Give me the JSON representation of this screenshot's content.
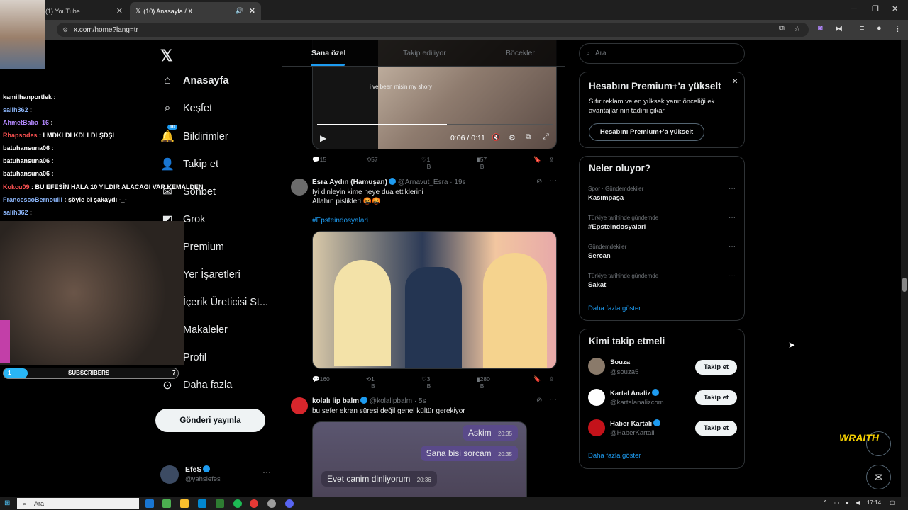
{
  "browser": {
    "tabs": [
      {
        "title": "(1) YouTube"
      },
      {
        "title": "(10) Anasayfa / X"
      }
    ],
    "url": "x.com/home?lang=tr"
  },
  "x": {
    "nav": [
      {
        "label": "Anasayfa",
        "icon": "home-icon"
      },
      {
        "label": "Keşfet",
        "icon": "search-icon"
      },
      {
        "label": "Bildirimler",
        "icon": "bell-icon",
        "badge": "10"
      },
      {
        "label": "Takip et",
        "icon": "add-user-icon"
      },
      {
        "label": "Sohbet",
        "icon": "chat-icon"
      },
      {
        "label": "Grok",
        "icon": "grok-icon"
      },
      {
        "label": "Premium",
        "icon": "x-logo-icon"
      },
      {
        "label": "Yer İşaretleri",
        "icon": "bookmark-icon"
      },
      {
        "label": "İçerik Üreticisi St...",
        "icon": "studio-icon"
      },
      {
        "label": "Makaleler",
        "icon": "article-icon"
      },
      {
        "label": "Profil",
        "icon": "person-icon"
      },
      {
        "label": "Daha fazla",
        "icon": "more-icon"
      }
    ],
    "post_button": "Gönderi yayınla",
    "account": {
      "name": "EfeS",
      "handle": "@yahslefes"
    },
    "feed_tabs": [
      "Sana özel",
      "Takip ediliyor",
      "Böcekler"
    ],
    "video_post": {
      "caption": "i ve been misin my shory",
      "time": "0:06 / 0:11",
      "stats": {
        "replies": "15",
        "reposts": "57",
        "likes": "1 B",
        "views": "57 B"
      }
    },
    "post1": {
      "name": "Esra Aydın (Hamuşan)",
      "handle": "@Arnavut_Esra",
      "time": "19s",
      "line1": "İyi dinleyin kime neye dua ettiklerini",
      "line2": "Allahın pislikleri 🤬🤬",
      "hashtag": "#Epsteindosyalari",
      "stats": {
        "replies": "160",
        "reposts": "1 B",
        "likes": "3 B",
        "views": "280 B"
      }
    },
    "post2": {
      "name": "kolalı lip balm",
      "handle": "@kolalipbalm",
      "time": "5s",
      "text": "bu sefer ekran süresi değil genel kültür gerekiyor",
      "bubbles": [
        {
          "text": "Askim",
          "time": "20:35",
          "side": "out"
        },
        {
          "text": "Sana bisi sorcam",
          "time": "20:35",
          "side": "out"
        },
        {
          "text": "Evet canim dinliyorum",
          "time": "20:36",
          "side": "in"
        }
      ]
    },
    "search_placeholder": "Ara",
    "premium": {
      "title": "Hesabını Premium+'a yükselt",
      "body": "Sıfır reklam ve en yüksek yanıt önceliği ek avantajlarının tadını çıkar.",
      "button": "Hesabını Premium+'a yükselt"
    },
    "trends": {
      "title": "Neler oluyor?",
      "items": [
        {
          "category": "Spor · Gündemdekiler",
          "name": "Kasımpaşa"
        },
        {
          "category": "Türkiye tarihinde gündemde",
          "name": "#Epsteindosyalari"
        },
        {
          "category": "Gündemdekiler",
          "name": "Sercan"
        },
        {
          "category": "Türkiye tarihinde gündemde",
          "name": "Sakat"
        }
      ],
      "more": "Daha fazla göster"
    },
    "who_to_follow": {
      "title": "Kimi takip etmeli",
      "items": [
        {
          "name": "Souza",
          "handle": "@souza5",
          "button": "Takip et"
        },
        {
          "name": "Kartal Analiz",
          "handle": "@kartalanalizcom",
          "button": "Takip et"
        },
        {
          "name": "Haber Kartalı",
          "handle": "@HaberKartali",
          "button": "Takip et"
        }
      ],
      "more": "Daha fazla göster"
    }
  },
  "stream": {
    "chat": [
      {
        "user": "kamilhanportlek",
        "msg": "",
        "color": "#ffffff"
      },
      {
        "user": "salih362",
        "msg": "",
        "color": "#8ab4f8"
      },
      {
        "user": "AhmetBaba_16",
        "msg": "",
        "color": "#b388ff"
      },
      {
        "user": "Rhapsodes",
        "msg": "LMDKLDLKDLLDLŞDŞL",
        "color": "#ff5252"
      },
      {
        "user": "batuhansuna06",
        "msg": "",
        "color": "#ffffff"
      },
      {
        "user": "batuhansuna06",
        "msg": "",
        "color": "#ffffff"
      },
      {
        "user": "batuhansuna06",
        "msg": "",
        "color": "#ffffff"
      },
      {
        "user": "Kokcu09",
        "msg": "BU EFESİN HALA 10 YILDIR ALACAGI VAR KEMALDEN",
        "color": "#ff5252"
      },
      {
        "user": "FrancescoBernoulli",
        "msg": "şöyle bi şakaydı -_-",
        "color": "#8ab4f8"
      },
      {
        "user": "salih362",
        "msg": "",
        "color": "#8ab4f8"
      }
    ],
    "subs": {
      "left": "1",
      "label": "SUBSCRIBERS",
      "right": "7",
      "progress": 0.14
    },
    "watermark": "WRAITH"
  },
  "taskbar": {
    "search": "Ara",
    "time": "17:14"
  }
}
